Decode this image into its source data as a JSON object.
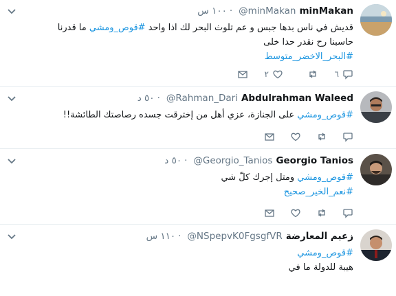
{
  "colors": {
    "link": "#1b95e0",
    "muted": "#657786",
    "text": "#14171a",
    "border": "#e6ecf0"
  },
  "tweets": [
    {
      "name": "minMakan",
      "handle": "@minMakan",
      "time": "١٠٠ س",
      "line1_text": "قديش في ناس بدها جبس و عم تلوث البحر لك اذا واحد ",
      "line1_tag": "#قوص_ومشي",
      "line1_rest": " ما قدرنا",
      "line2": "حاسبنا رح نقدر حدا خلى",
      "line3_tag": "#البحر_الاخضر_متوسط",
      "reply_count": "٦",
      "retweet_count": "",
      "like_count": "٢"
    },
    {
      "name": "Abdulrahman Waleed",
      "handle": "@Rahman_Dari",
      "time": "٥٠ د",
      "line1_tag": "#قوص_ومشي",
      "line1_rest": " على الجنازة، عزي أهل من إخترقت جسده رصاصتك الطائشة!!"
    },
    {
      "name": "Georgio Tanios",
      "handle": "@Georgio_Tanios",
      "time": "٥٠ د",
      "line1_tag": "#قوص_ومشي",
      "line1_rest": " ومتل إجرك كلّ شي",
      "line2_tag": "#نعم_الخير_صحيح"
    },
    {
      "name": "زعيم المعارضة",
      "handle": "@NSpepvK0FgsgfVR",
      "time": "١١٠ س",
      "line1_tag": "#قوص_ومشي",
      "line2": "هيبة للدولة ما في"
    }
  ],
  "icons": {
    "caret": "chevron-down-icon",
    "reply": "reply-icon",
    "retweet": "retweet-icon",
    "like": "heart-icon",
    "dm": "envelope-icon"
  }
}
